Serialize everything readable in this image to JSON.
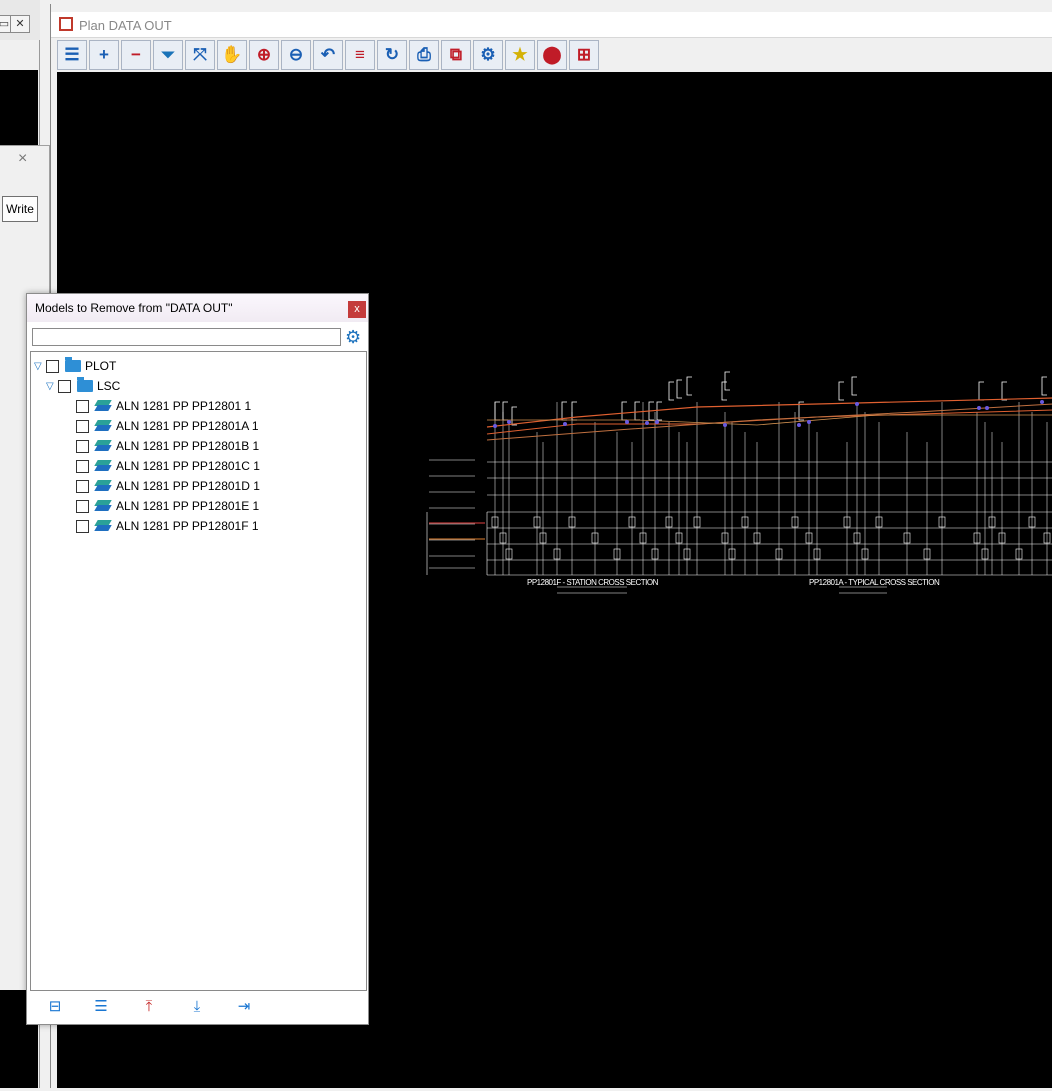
{
  "left_window": {
    "sys_buttons": [
      "▭",
      "✕"
    ],
    "write_label": "Write",
    "close_glyph": "×"
  },
  "plan_window": {
    "title": "Plan DATA OUT",
    "toolbar": [
      {
        "icon": "menu-icon",
        "glyph": "☰",
        "color": "#1a5fb4"
      },
      {
        "icon": "zoom-in-plus-icon",
        "glyph": "+",
        "color": "#1a5fb4"
      },
      {
        "icon": "zoom-out-minus-icon",
        "glyph": "−",
        "color": "#c01c28"
      },
      {
        "icon": "pan-funnel-icon",
        "glyph": "⏷",
        "color": "#1a73b8"
      },
      {
        "icon": "fit-extents-icon",
        "glyph": "⤧",
        "color": "#1a5fb4"
      },
      {
        "icon": "hand-pan-icon",
        "glyph": "✋",
        "color": "#1a5fb4"
      },
      {
        "icon": "zoom-window-icon",
        "glyph": "⊕",
        "color": "#c01c28"
      },
      {
        "icon": "zoom-out-window-icon",
        "glyph": "⊖",
        "color": "#1a5fb4"
      },
      {
        "icon": "undo-view-icon",
        "glyph": "↶",
        "color": "#1a5fb4"
      },
      {
        "icon": "layers-toggle-icon",
        "glyph": "≡",
        "color": "#c01c28"
      },
      {
        "icon": "redraw-icon",
        "glyph": "↻",
        "color": "#1a5fb4"
      },
      {
        "icon": "print-icon",
        "glyph": "⎙",
        "color": "#1a5fb4"
      },
      {
        "icon": "plot-export-icon",
        "glyph": "⧉",
        "color": "#c01c28"
      },
      {
        "icon": "settings-gear-icon",
        "glyph": "⚙",
        "color": "#1a5fb4"
      },
      {
        "icon": "favorite-star-icon",
        "glyph": "★",
        "color": "#d4b106"
      },
      {
        "icon": "location-pin-icon",
        "glyph": "⬤",
        "color": "#c01c28"
      },
      {
        "icon": "grid-layout-icon",
        "glyph": "⊞",
        "color": "#c01c28"
      }
    ],
    "section_labels": [
      "PP12801F - STATION CROSS SECTION",
      "PP12801A - TYPICAL CROSS SECTION"
    ]
  },
  "dialog": {
    "title": "Models to Remove from \"DATA OUT\"",
    "close_label": "x",
    "search_value": "",
    "tree": {
      "root": "PLOT",
      "folder": "LSC",
      "models": [
        "ALN 1281 PP PP12801 1",
        "ALN 1281 PP PP12801A 1",
        "ALN 1281 PP PP12801B 1",
        "ALN 1281 PP PP12801C 1",
        "ALN 1281 PP PP12801D 1",
        "ALN 1281 PP PP12801E 1",
        "ALN 1281 PP PP12801F 1"
      ]
    },
    "bottom_icons": [
      {
        "icon": "collapse-icon",
        "glyph": "⊟"
      },
      {
        "icon": "clear-list-icon",
        "glyph": "☰"
      },
      {
        "icon": "move-top-icon",
        "glyph": "⤒"
      },
      {
        "icon": "move-bottom-icon",
        "glyph": "⤓"
      },
      {
        "icon": "import-icon",
        "glyph": "⇥"
      }
    ]
  }
}
